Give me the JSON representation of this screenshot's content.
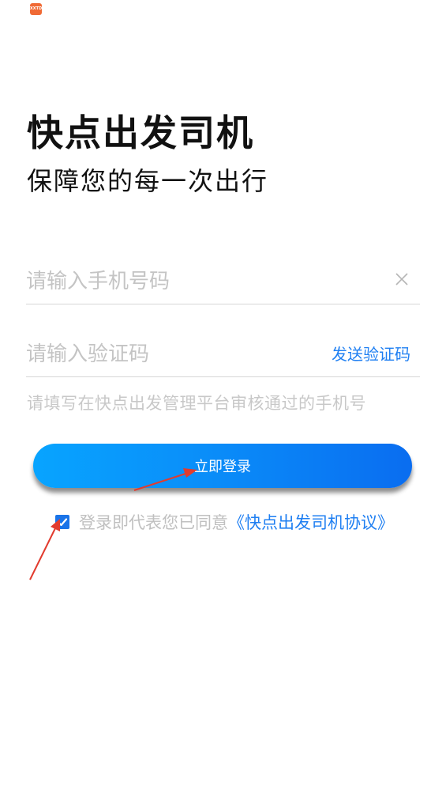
{
  "status_bar": {
    "app_icon": "app-icon",
    "app_icon_text": "XXTD"
  },
  "header": {
    "title": "快点出发司机",
    "subtitle": "保障您的每一次出行"
  },
  "form": {
    "phone": {
      "placeholder": "请输入手机号码",
      "value": "",
      "clear_icon": "close-icon"
    },
    "code": {
      "placeholder": "请输入验证码",
      "value": "",
      "send_label": "发送验证码"
    },
    "hint": "请填写在快点出发管理平台审核通过的手机号"
  },
  "login_button": {
    "label": "立即登录"
  },
  "agreement": {
    "checked": true,
    "text": "登录即代表您已同意",
    "link_text": "《快点出发司机协议》"
  },
  "annotations": {
    "arrow_color": "#e23b2e"
  },
  "colors": {
    "accent": "#1f7ff2",
    "button_gradient_start": "#08a4ff",
    "button_gradient_end": "#0a6df0",
    "placeholder": "#c4c4c4"
  }
}
